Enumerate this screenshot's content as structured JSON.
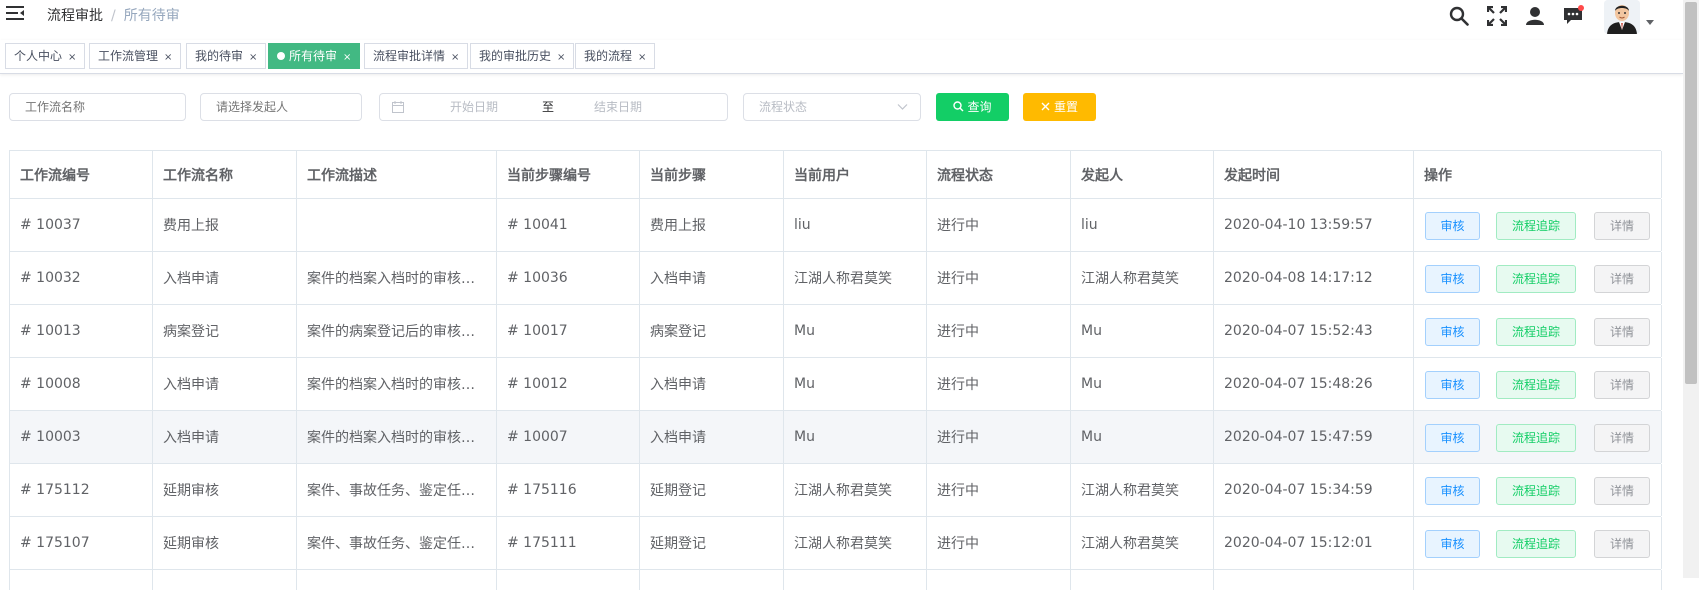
{
  "breadcrumb": {
    "home": "流程审批",
    "separator": "/",
    "current": "所有待审"
  },
  "tags": [
    {
      "label": "个人中心",
      "active": false
    },
    {
      "label": "工作流管理",
      "active": false
    },
    {
      "label": "我的待审",
      "active": false
    },
    {
      "label": "所有待审",
      "active": true
    },
    {
      "label": "流程审批详情",
      "active": false
    },
    {
      "label": "我的审批历史",
      "active": false
    },
    {
      "label": "我的流程",
      "active": false
    }
  ],
  "tag_close": "×",
  "filters": {
    "workflow_name_placeholder": "工作流名称",
    "initiator_placeholder": "请选择发起人",
    "start_date_placeholder": "开始日期",
    "end_date_placeholder": "结束日期",
    "date_separator": "至",
    "status_placeholder": "流程状态",
    "search_label": "查询",
    "reset_label": "重置"
  },
  "table": {
    "columns": [
      "工作流编号",
      "工作流名称",
      "工作流描述",
      "当前步骤编号",
      "当前步骤",
      "当前用户",
      "流程状态",
      "发起人",
      "发起时间",
      "操作"
    ],
    "action_labels": {
      "audit": "审核",
      "trace": "流程追踪",
      "detail": "详情"
    },
    "rows": [
      [
        "# 10037",
        "费用上报",
        "",
        "# 10041",
        "费用上报",
        "liu",
        "进行中",
        "liu",
        "2020-04-10 13:59:57"
      ],
      [
        "# 10032",
        "入档申请",
        "案件的档案入档时的审核…",
        "# 10036",
        "入档申请",
        "江湖人称君莫笑",
        "进行中",
        "江湖人称君莫笑",
        "2020-04-08 14:17:12"
      ],
      [
        "# 10013",
        "病案登记",
        "案件的病案登记后的审核…",
        "# 10017",
        "病案登记",
        "Mu",
        "进行中",
        "Mu",
        "2020-04-07 15:52:43"
      ],
      [
        "# 10008",
        "入档申请",
        "案件的档案入档时的审核…",
        "# 10012",
        "入档申请",
        "Mu",
        "进行中",
        "Mu",
        "2020-04-07 15:48:26"
      ],
      [
        "# 10003",
        "入档申请",
        "案件的档案入档时的审核…",
        "# 10007",
        "入档申请",
        "Mu",
        "进行中",
        "Mu",
        "2020-04-07 15:47:59"
      ],
      [
        "# 175112",
        "延期审核",
        "案件、事故任务、鉴定任…",
        "# 175116",
        "延期登记",
        "江湖人称君莫笑",
        "进行中",
        "江湖人称君莫笑",
        "2020-04-07 15:34:59"
      ],
      [
        "# 175107",
        "延期审核",
        "案件、事故任务、鉴定任…",
        "# 175111",
        "延期登记",
        "江湖人称君莫笑",
        "进行中",
        "江湖人称君莫笑",
        "2020-04-07 15:12:01"
      ]
    ],
    "highlighted_row": 4
  },
  "icons": {
    "hamburger": "hamburger-icon",
    "search": "search-icon",
    "fullscreen": "fullscreen-icon",
    "user": "user-icon",
    "message": "message-icon",
    "calendar": "calendar-icon",
    "chevron": "chevron-down-icon",
    "reset": "close-icon"
  },
  "colors": {
    "active_tag": "#42b983",
    "search_button": "#13ce66",
    "reset_button": "#ffba00",
    "audit": "#1890ff",
    "trace": "#13ce66",
    "detail": "#909399",
    "notification_dot": "#ff4949"
  }
}
